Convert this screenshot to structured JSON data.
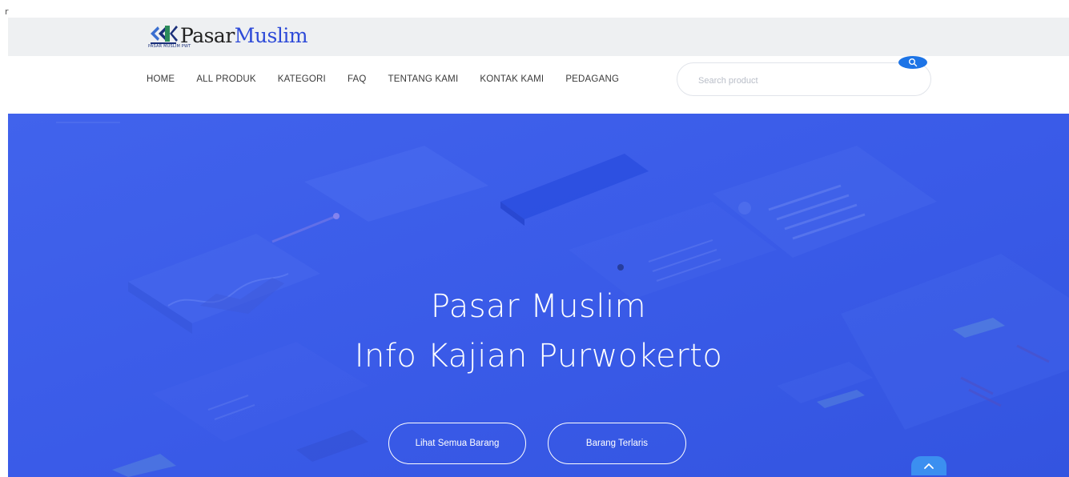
{
  "corner_mark": "r",
  "logo": {
    "text_part1": "Pasar",
    "text_part2": "Muslim",
    "subtext": "PASAR MUSLIM PWT"
  },
  "nav": {
    "items": [
      {
        "label": "HOME"
      },
      {
        "label": "ALL PRODUK"
      },
      {
        "label": "KATEGORI"
      },
      {
        "label": "FAQ"
      },
      {
        "label": "TENTANG KAMI"
      },
      {
        "label": "KONTAK KAMI"
      },
      {
        "label": "PEDAGANG"
      }
    ]
  },
  "search": {
    "placeholder": "Search product",
    "value": "",
    "icon": "search-icon"
  },
  "hero": {
    "title_line1": "Pasar Muslim",
    "title_line2": "Info Kajian Purwokerto",
    "buttons": [
      {
        "label": "Lihat Semua Barang"
      },
      {
        "label": "Barang Terlaris"
      }
    ],
    "scroll_top_icon": "chevron-up-icon"
  },
  "colors": {
    "brand_blue": "#2d4ad8",
    "hero_background": "#3a5be8",
    "search_button": "#1d74e6",
    "logo_bar_background": "#eef0f2"
  }
}
